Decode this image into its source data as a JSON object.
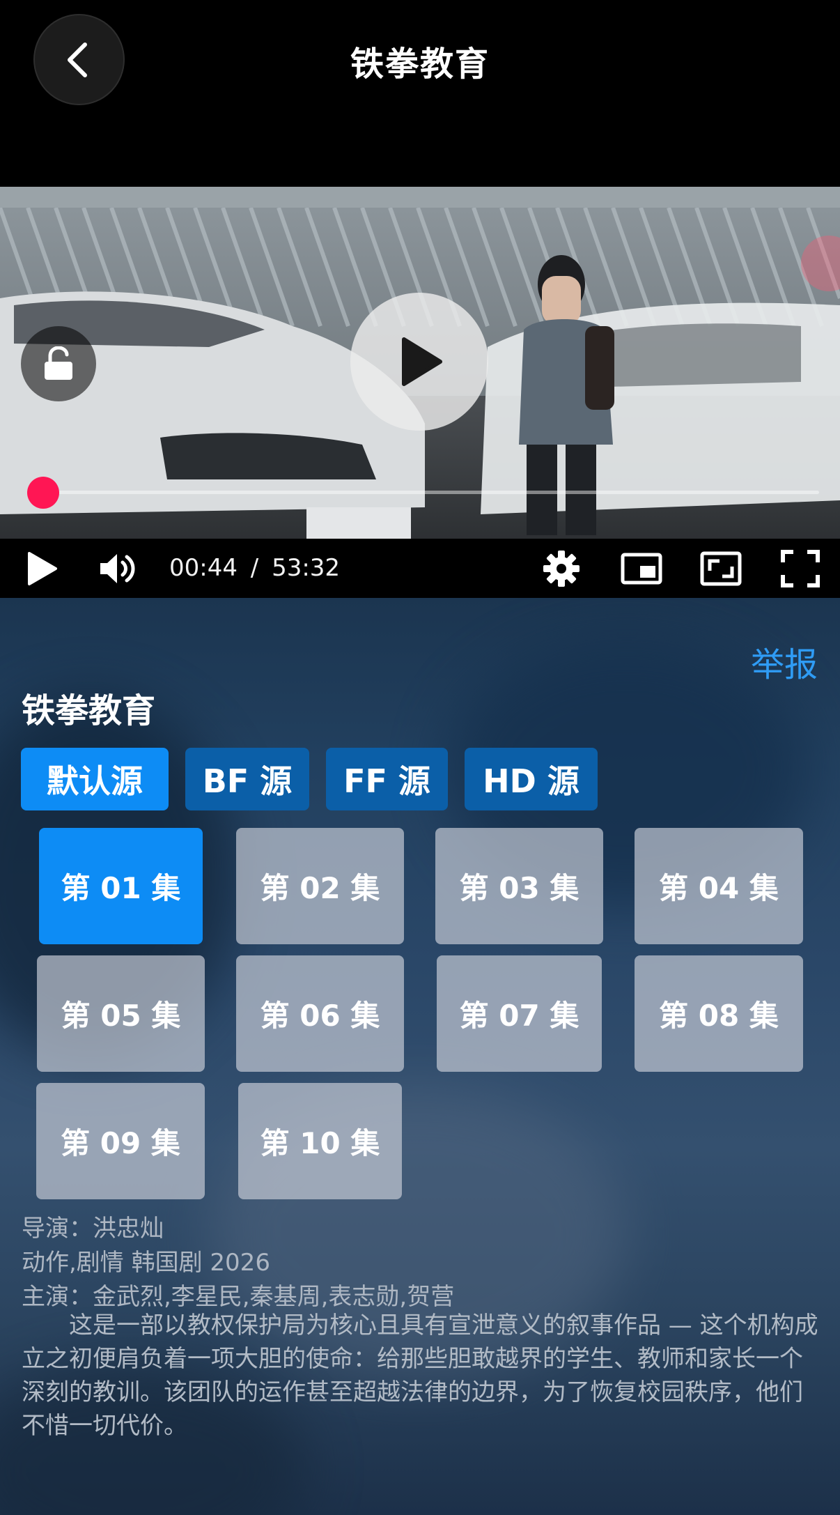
{
  "header": {
    "title": "铁拳教育"
  },
  "player": {
    "current_time": "00:44",
    "separator": "/",
    "duration": "53:32",
    "progress": 0.014,
    "accent": "#ff1654"
  },
  "icons": {
    "back": "chevron-left-icon",
    "lock": "unlock-icon",
    "play_overlay": "play-icon",
    "play": "play-icon",
    "volume": "volume-icon",
    "settings": "gear-icon",
    "pip": "picture-in-picture-icon",
    "expand": "expand-icon",
    "fullscreen": "fullscreen-icon"
  },
  "detail": {
    "report_label": "举报",
    "title": "铁拳教育",
    "sources": [
      {
        "label": "默认源",
        "active": true
      },
      {
        "label": "BF 源",
        "active": false
      },
      {
        "label": "FF 源",
        "active": false
      },
      {
        "label": "HD 源",
        "active": false
      }
    ],
    "episodes": [
      {
        "label": "第 01 集",
        "active": true
      },
      {
        "label": "第 02 集",
        "active": false
      },
      {
        "label": "第 03 集",
        "active": false
      },
      {
        "label": "第 04 集",
        "active": false
      },
      {
        "label": "第 05 集",
        "active": false
      },
      {
        "label": "第 06 集",
        "active": false
      },
      {
        "label": "第 07 集",
        "active": false
      },
      {
        "label": "第 08 集",
        "active": false
      },
      {
        "label": "第 09 集",
        "active": false
      },
      {
        "label": "第 10 集",
        "active": false
      }
    ],
    "director": "导演：洪忠灿",
    "genre_line": "动作,剧情 韩国剧 2026",
    "cast": "主演：金武烈,李星民,秦基周,表志勋,贺营",
    "synopsis": "这是一部以教权保护局为核心且具有宣泄意义的叙事作品 — 这个机构成立之初便肩负着一项大胆的使命：给那些胆敢越界的学生、教师和家长一个深刻的教训。该团队的运作甚至超越法律的边界，为了恢复校园秩序，他们不惜一切代价。"
  },
  "colors": {
    "accent_blue": "#0d8cf5",
    "source_inactive": "#0b5fa8",
    "report_link": "#2f9cf5"
  }
}
